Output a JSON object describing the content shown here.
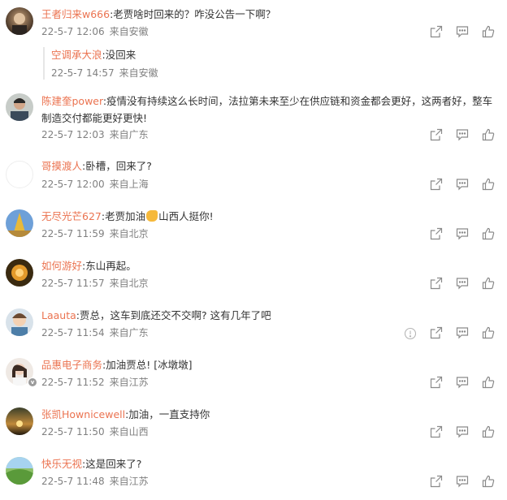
{
  "comments": [
    {
      "user": "王者归来w666",
      "text": ":老贾啥时回来的？咋没公告一下啊？",
      "time": "22-5-7 12:06",
      "loc": "来自安徽",
      "reply": {
        "user": "空调承大浪",
        "text": ":没回来",
        "time": "22-5-7 14:57",
        "loc": "来自安徽"
      }
    },
    {
      "user": "陈建奎power",
      "text": ":疫情没有持续这么长时间，法拉第未来至少在供应链和资金都会更好，这两者好，整车制造交付都能更好更快!",
      "time": "22-5-7 12:03",
      "loc": "来自广东"
    },
    {
      "user": "哥摸渡人",
      "text": ":卧槽，回来了?",
      "time": "22-5-7 12:00",
      "loc": "来自上海"
    },
    {
      "user": "无尽光芒627",
      "text_before": ":老贾加油",
      "emoji": "flexed-biceps",
      "text_after": "山西人挺你!",
      "time": "22-5-7 11:59",
      "loc": "来自北京"
    },
    {
      "user": "如何游好",
      "text": ":东山再起。",
      "time": "22-5-7 11:57",
      "loc": "来自北京"
    },
    {
      "user": "Laauta",
      "text": ":贾总，这车到底还交不交啊? 这有几年了吧",
      "time": "22-5-7 11:54",
      "loc": "来自广东",
      "report": true
    },
    {
      "user": "品惠电子商务",
      "text": ":加油贾总! [冰墩墩]",
      "time": "22-5-7 11:52",
      "loc": "来自江苏",
      "verified": true
    },
    {
      "user": "张凯Hownicewell",
      "text": ":加油，一直支持你",
      "time": "22-5-7 11:50",
      "loc": "来自山西"
    },
    {
      "user": "快乐无视",
      "text": ":这是回来了?",
      "time": "22-5-7 11:48",
      "loc": "来自江苏"
    }
  ],
  "icons": {
    "share": "share-icon",
    "comment": "comment-icon",
    "like": "like-icon",
    "report": "report-icon"
  },
  "colors": {
    "username": "#eb7350",
    "meta": "#808080",
    "text": "#333333",
    "icon": "#8a8a8a"
  }
}
